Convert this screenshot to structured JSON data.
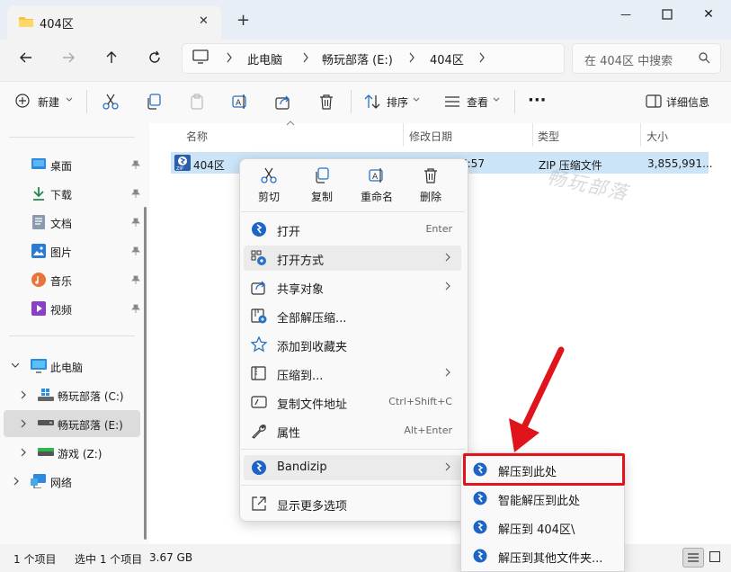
{
  "window": {
    "tab_title": "404区",
    "new_tab": "+",
    "tab_close": "✕",
    "min": "—",
    "max": "☐",
    "close": "✕"
  },
  "address": {
    "crumbs": [
      "此电脑",
      "畅玩部落 (E:)",
      "404区"
    ],
    "search_placeholder": "在 404区 中搜索"
  },
  "toolbar": {
    "new": "新建",
    "sort": "排序",
    "view": "查看",
    "more": "···",
    "details": "详细信息"
  },
  "sidebar": {
    "quick": [
      {
        "label": "桌面"
      },
      {
        "label": "下载"
      },
      {
        "label": "文档"
      },
      {
        "label": "图片"
      },
      {
        "label": "音乐"
      },
      {
        "label": "视频"
      }
    ],
    "this_pc": "此电脑",
    "drives": [
      "畅玩部落 (C:)",
      "畅玩部落 (E:)",
      "游戏 (Z:)"
    ],
    "network": "网络"
  },
  "columns": {
    "name": "名称",
    "modified": "修改日期",
    "type": "类型",
    "size": "大小"
  },
  "file": {
    "name": "404区",
    "modified_partial": "7:57",
    "type": "ZIP 压缩文件",
    "size": "3,855,991..."
  },
  "watermark": "畅玩部落",
  "context_menu": {
    "quick_actions": [
      "剪切",
      "复制",
      "重命名",
      "删除"
    ],
    "items": [
      {
        "label": "打开",
        "shortcut": "Enter"
      },
      {
        "label": "打开方式",
        "shortcut": ""
      },
      {
        "label": "共享对象",
        "shortcut": ""
      },
      {
        "label": "全部解压缩...",
        "shortcut": ""
      },
      {
        "label": "添加到收藏夹",
        "shortcut": ""
      },
      {
        "label": "压缩到...",
        "shortcut": ""
      },
      {
        "label": "复制文件地址",
        "shortcut": "Ctrl+Shift+C"
      },
      {
        "label": "属性",
        "shortcut": "Alt+Enter"
      }
    ],
    "bandizip": "Bandizip",
    "more_options": "显示更多选项"
  },
  "submenu": {
    "items": [
      "解压到此处",
      "智能解压到此处",
      "解压到 404区\\",
      "解压到其他文件夹..."
    ]
  },
  "status": {
    "count": "1 个项目",
    "selected": "选中 1 个项目",
    "size": "3.67 GB"
  },
  "colors": {
    "accent": "#005fb8",
    "highlight_box": "#e0141b",
    "arrow": "#e0141b"
  }
}
